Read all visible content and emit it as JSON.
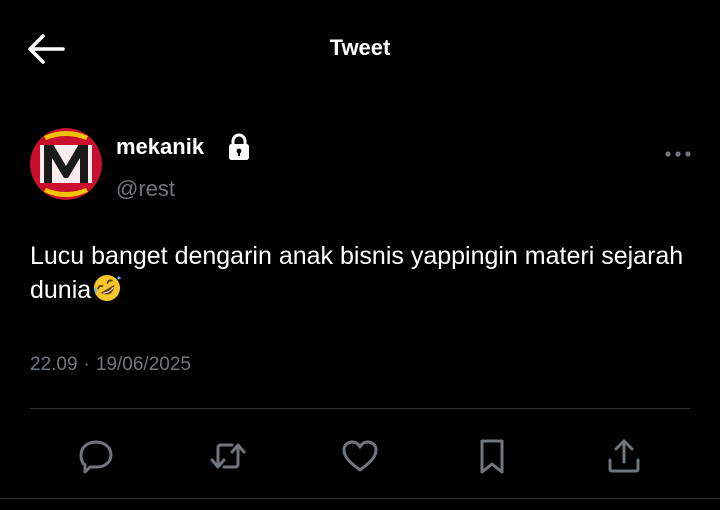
{
  "header": {
    "title": "Tweet",
    "back_icon": "arrow-left-icon"
  },
  "author": {
    "display_name": "mekanik",
    "handle": "@rest",
    "protected_icon": "lock-icon",
    "avatar_letter": "M",
    "avatar_colors": {
      "background": "#c8102e",
      "letter": "#1a1a1a",
      "accent": "#f2c300"
    }
  },
  "tweet": {
    "text": "Lucu banget dengarin anak bisnis yappingin materi sejarah dunia",
    "emoji_icon": "rolling-on-the-floor-laughing-emoji"
  },
  "meta": {
    "time": "22.09",
    "separator": "·",
    "date": "19/06/2025"
  },
  "actions": [
    {
      "name": "reply",
      "icon": "reply-icon"
    },
    {
      "name": "retweet",
      "icon": "retweet-icon"
    },
    {
      "name": "like",
      "icon": "heart-icon"
    },
    {
      "name": "bookmark",
      "icon": "bookmark-icon"
    },
    {
      "name": "share",
      "icon": "share-icon"
    }
  ],
  "colors": {
    "background": "#000000",
    "primary_text": "#ffffff",
    "secondary_text": "#71767b",
    "icon": "#71767b",
    "divider": "#2f3336"
  }
}
